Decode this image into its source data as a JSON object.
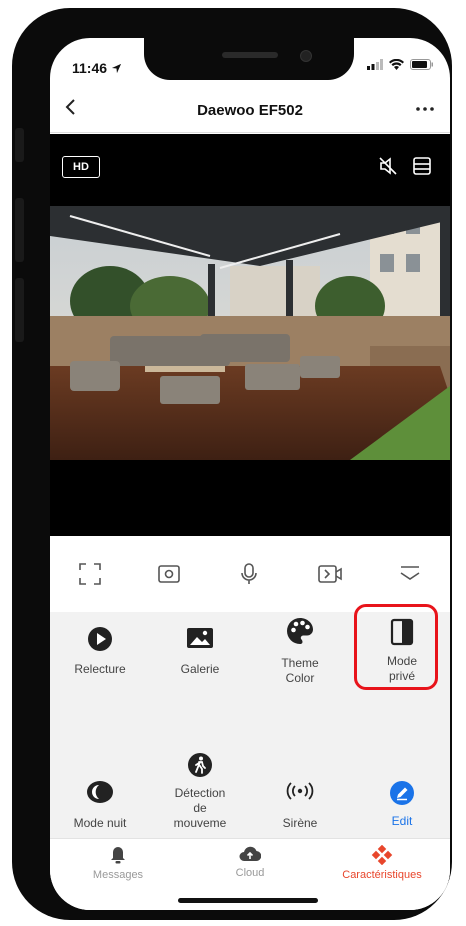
{
  "status": {
    "time": "11:46"
  },
  "nav": {
    "title": "Daewoo EF502"
  },
  "video": {
    "quality_label": "HD"
  },
  "features_row1": [
    {
      "label": "Relecture",
      "icon": "play-circle-icon"
    },
    {
      "label": "Galerie",
      "icon": "image-icon"
    },
    {
      "label": "Theme Color",
      "icon": "palette-icon"
    },
    {
      "label": "Mode privé",
      "icon": "privacy-shield-icon"
    }
  ],
  "features_row2": [
    {
      "label": "Mode nuit",
      "icon": "moon-icon"
    },
    {
      "label": "Détection de mouveme",
      "icon": "motion-walker-icon"
    },
    {
      "label": "Sirène",
      "icon": "siren-icon"
    },
    {
      "label": "Edit",
      "icon": "edit-icon"
    }
  ],
  "tabs": [
    {
      "label": "Messages",
      "icon": "bell-icon"
    },
    {
      "label": "Cloud",
      "icon": "cloud-icon"
    },
    {
      "label": "Caractéristiques",
      "icon": "features-icon"
    }
  ],
  "colors": {
    "accent": "#e8141b",
    "active_tab": "#e8462c",
    "edit_blue": "#1a73e8"
  }
}
